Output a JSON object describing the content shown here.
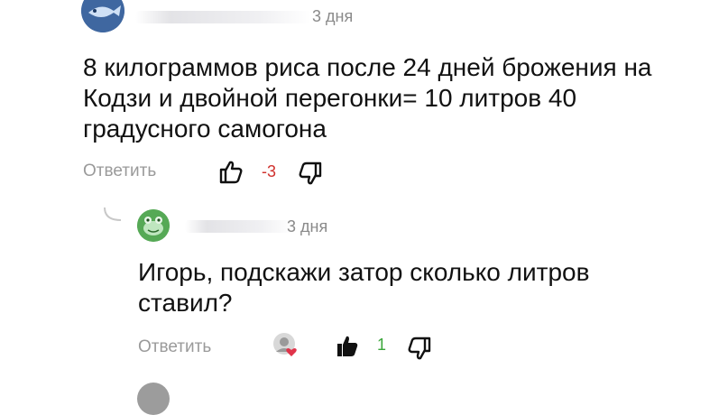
{
  "comments": [
    {
      "time": "3 дня",
      "text_lines": [
        "8 килограммов риса после 24 дней брожения на",
        "Кодзи и двойной перегонки= 10 литров 40",
        "градусного самогона"
      ],
      "reply_label": "Ответить",
      "rating": "-3",
      "rating_color": "#d0312d",
      "avatar_icon": "fish-avatar-icon"
    },
    {
      "time": "3 дня",
      "text_lines": [
        "Игорь, подскажи затор сколько литров",
        "ставил?"
      ],
      "reply_label": "Ответить",
      "rating": "1",
      "rating_color": "#3aa63a",
      "avatar_icon": "frog-avatar-icon",
      "reaction_icon": "liked-by-author-icon"
    }
  ]
}
